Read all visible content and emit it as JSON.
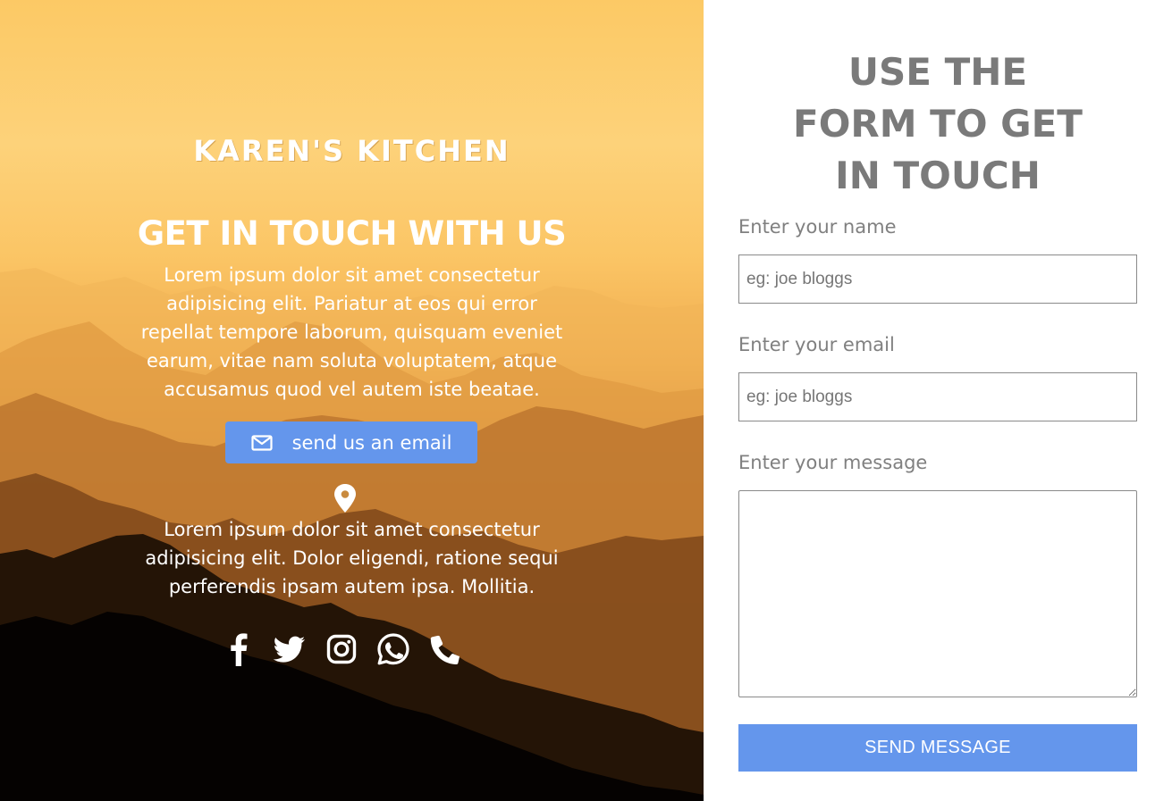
{
  "left": {
    "brand": "KAREN'S KITCHEN",
    "headline": "GET IN TOUCH WITH US",
    "intro": "Lorem ipsum dolor sit amet consectetur adipisicing elit. Pariatur at eos qui error repellat tempore laborum, quisquam eveniet earum, vitae nam soluta voluptatem, atque accusamus quod vel autem iste beatae.",
    "email_button": {
      "label": "send us an email",
      "icon": "envelope-icon"
    },
    "location": {
      "icon": "map-pin-icon",
      "text": "Lorem ipsum dolor sit amet consectetur adipisicing elit. Dolor eligendi, ratione sequi perferendis ipsam autem ipsa. Mollitia."
    },
    "socials": [
      "facebook-icon",
      "twitter-icon",
      "instagram-icon",
      "whatsapp-icon",
      "phone-icon"
    ]
  },
  "form": {
    "title": "USE THE FORM TO GET IN TOUCH",
    "name_label": "Enter your name",
    "name_placeholder": "eg: joe bloggs",
    "email_label": "Enter your email",
    "email_placeholder": "eg: joe bloggs",
    "message_label": "Enter your message",
    "submit_label": "SEND MESSAGE"
  },
  "colors": {
    "accent": "#6496ec",
    "form_text": "#7a7a7a",
    "sky_top": "#fcc965"
  }
}
